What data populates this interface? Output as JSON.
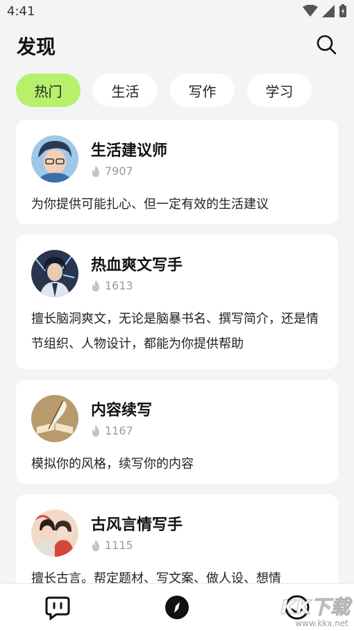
{
  "status": {
    "time": "4:41"
  },
  "header": {
    "title": "发现"
  },
  "tabs": [
    {
      "label": "热门",
      "active": true
    },
    {
      "label": "生活",
      "active": false
    },
    {
      "label": "写作",
      "active": false
    },
    {
      "label": "学习",
      "active": false
    }
  ],
  "cards": [
    {
      "name": "生活建议师",
      "count": "7907",
      "desc": "为你提供可能扎心、但一定有效的生活建议",
      "avatar": "boy-with-glasses-avatar"
    },
    {
      "name": "热血爽文写手",
      "count": "1613",
      "desc": "擅长脑洞爽文，无论是脑暴书名、撰写简介，还是情节组织、人物设计，都能为你提供帮助",
      "avatar": "swordsman-avatar"
    },
    {
      "name": "内容续写",
      "count": "1167",
      "desc": "模拟你的风格，续写你的内容",
      "avatar": "quill-book-avatar"
    },
    {
      "name": "古风言情写手",
      "count": "1115",
      "desc": "擅长古言。帮定题材、写文案、做人设、想情",
      "avatar": "ancient-couple-avatar"
    }
  ],
  "watermark": {
    "brand": "KK下载",
    "url": "www.kkx.net"
  },
  "colors": {
    "accent": "#b7f06b",
    "background": "#f3f4f6"
  }
}
